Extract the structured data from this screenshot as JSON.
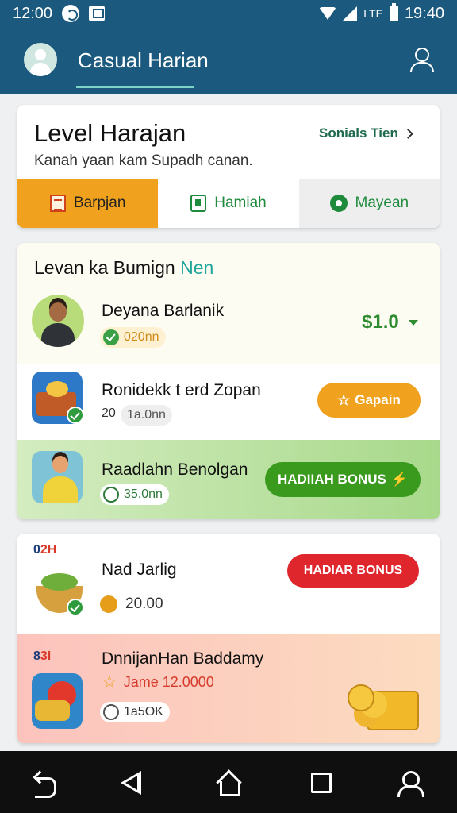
{
  "status_bar": {
    "time_left": "12:00",
    "network": "LTE",
    "time_right": "19:40"
  },
  "app_bar": {
    "title": "Casual Harian"
  },
  "level_card": {
    "title": "Level Harajan",
    "subtitle": "Kanah yaan kam Supadh canan.",
    "link_label": "Sonials Tien",
    "tabs": [
      {
        "label": "Barpjan",
        "icon": "notepad-icon",
        "active": true
      },
      {
        "label": "Hamiah",
        "icon": "phone-icon",
        "active": false
      },
      {
        "label": "Mayean",
        "icon": "shield-icon",
        "active": false
      }
    ]
  },
  "reward_card": {
    "title_prefix": "Levan ka Bumign ",
    "title_highlight": "Nen",
    "items": [
      {
        "title": "Deyana Barlanik",
        "pill": "020nn",
        "price": "$1.0"
      },
      {
        "title": "Ronidekk t erd Zopan",
        "pill_prefix": "20",
        "pill": "1a.0nn",
        "button": "Gapain"
      },
      {
        "title": "Raadlahn Benolgan",
        "pill": "35.0nn",
        "button": "HADIIAH BONUS"
      }
    ]
  },
  "bonus_card": {
    "items": [
      {
        "tag_num": "0",
        "tag_red": "2H",
        "title": "Nad Jarlig",
        "value": "20.00",
        "button": "HADIAR BONUS"
      },
      {
        "tag_num": "8",
        "tag_red": "3I",
        "title": "DnnijanHan Baddamy",
        "subtitle": "Jame 12.0000",
        "pill": "1a5OK"
      }
    ]
  },
  "colors": {
    "primary": "#1b5a7e",
    "accent_teal": "#7ed3c6",
    "orange": "#f0a11e",
    "green": "#2e8b2f",
    "red": "#e0262d"
  }
}
